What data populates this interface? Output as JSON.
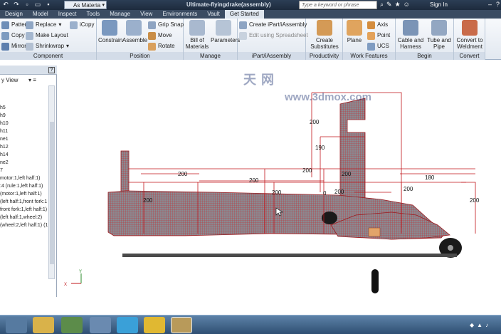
{
  "titlebar": {
    "material": "As Materia",
    "title": "Ultimate-flyingdrake(assembly)",
    "search_placeholder": "Type a keyword or phrase",
    "sign_in": "Sign In"
  },
  "tabs": [
    "Design",
    "Model",
    "Inspect",
    "Tools",
    "Manage",
    "View",
    "Environments",
    "Vault",
    "Get Started"
  ],
  "ribbon": {
    "component": {
      "label": "Component",
      "pattern": "Pattern",
      "replace": "Replace",
      "icopy": "iCopy",
      "copy": "Copy",
      "make_layout": "Make Layout",
      "mirror": "Mirror",
      "shrinkwrap": "Shrinkwrap"
    },
    "position": {
      "label": "Position",
      "constrain": "Constrain",
      "assemble": "Assemble",
      "grip_snap": "Grip Snap",
      "move": "Move",
      "rotate": "Rotate"
    },
    "manage": {
      "label": "Manage",
      "bill_of_materials": "Bill of Materials",
      "parameters": "Parameters"
    },
    "ipart": {
      "label": "iPart/iAssembly",
      "create_ipart": "Create iPart/iAssembly",
      "edit_spreadsheet": "Edit using Spreadsheet"
    },
    "productivity": {
      "label": "Productivity",
      "create_substitutes": "Create Substitutes"
    },
    "work_features": {
      "label": "Work Features",
      "plane": "Plane",
      "axis": "Axis",
      "point": "Point",
      "ucs": "UCS"
    },
    "begin": {
      "label": "Begin",
      "cable_harness": "Cable and Harness",
      "tube_pipe": "Tube and Pipe"
    },
    "convert": {
      "label": "Convert",
      "convert_weldment": "Convert to Weldment"
    }
  },
  "browser": {
    "help": "?",
    "view": "y View",
    "items": [
      "h5",
      "h9",
      "h10",
      "h11",
      "ne1",
      "h12",
      "h14",
      "ne2",
      "7",
      "motor:1,left half:1)",
      ":4 (rule:1,left half:1)",
      "(motor:1,left half:1)",
      "(left half:1,front fork:1",
      "front fork:1,left half:1)",
      "(left half:1,wheel:2)",
      "(wheel:2,left half:1) (1"
    ]
  },
  "canvas": {
    "watermark_cn": "天  网",
    "watermark_url": "www.3dmox.com",
    "dims": [
      "200",
      "200",
      "200",
      "200",
      "200",
      "200",
      "190",
      "200",
      "180",
      "200",
      "200",
      "200",
      "200",
      "0"
    ],
    "triad": {
      "x": "X",
      "y": "Y"
    }
  },
  "colors": {
    "ribbon_dark": "#3a4b62",
    "sketch_red": "#c0141a",
    "taskbar": "#3f6389"
  },
  "icons": {
    "qa": [
      "undo-icon",
      "redo-icon",
      "new-icon",
      "open-icon",
      "save-icon"
    ],
    "taskbar_apps": [
      "media-player-icon",
      "explorer-icon",
      "chrome-icon",
      "search-icon",
      "skype-icon",
      "vectorworks-icon",
      "inventor-icon"
    ]
  }
}
